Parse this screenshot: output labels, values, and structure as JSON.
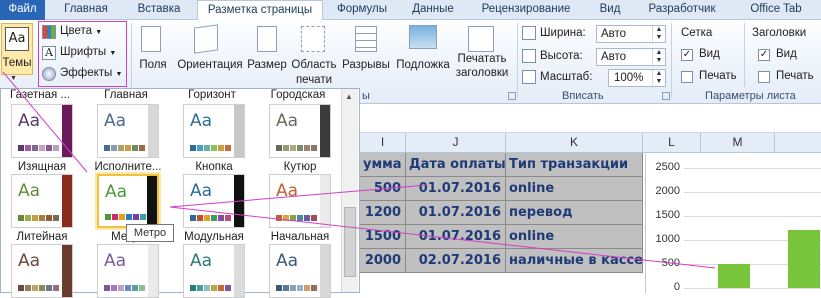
{
  "tabs": [
    {
      "label": "Файл",
      "kind": "file"
    },
    {
      "label": "Главная"
    },
    {
      "label": "Вставка"
    },
    {
      "label": "Разметка страницы",
      "kind": "active"
    },
    {
      "label": "Формулы"
    },
    {
      "label": "Данные"
    },
    {
      "label": "Рецензирование"
    },
    {
      "label": "Вид"
    },
    {
      "label": "Разработчик"
    },
    {
      "label": "Office Tab"
    }
  ],
  "ribbon": {
    "themes_label": "Темы",
    "colors_label": "Цвета",
    "fonts_label": "Шрифты",
    "effects_label": "Эффекты",
    "fields_label": "Поля",
    "orientation_label": "Ориентация",
    "size_label": "Размер",
    "print_area_label_1": "Область",
    "print_area_label_2": "печати",
    "breaks_label": "Разрывы",
    "background_label": "Подложка",
    "print_titles_label_1": "Печатать",
    "print_titles_label_2": "заголовки",
    "width_label": "Ширина:",
    "width_value": "Авто",
    "height_label": "Высота:",
    "height_value": "Авто",
    "scale_label": "Масштаб:",
    "scale_value": "100%",
    "fit_group_label": "Вписать",
    "page_setup_partial": "ы",
    "grid_label": "Сетка",
    "headings_label": "Заголовки",
    "view_label": "Вид",
    "print_label": "Печать",
    "sheet_options_label": "Параметры листа"
  },
  "gallery": {
    "top_labels": [
      "Газетная ...",
      "Главная",
      "Горизонт",
      "Городская"
    ],
    "row1": [
      {
        "name": "Изящная",
        "colors": [
          "#5a3a6e",
          "#a35c9e",
          "#7a6a8c",
          "#c8a0c4",
          "#8a5a8c",
          "#b3a3c2"
        ],
        "stripe": "#6a1a5a"
      },
      {
        "name": "Исполните...",
        "colors": [
          "#4b6a8e",
          "#8a9ab0",
          "#b0a070",
          "#c8a040",
          "#6a8a6a",
          "#9a6a4a"
        ],
        "stripe": "#d8d8d8"
      },
      {
        "name": "Кнопка",
        "colors": [
          "#2e6c94",
          "#4aa0c8",
          "#6ab0a0",
          "#8ac060",
          "#c8a040",
          "#d06a3a"
        ],
        "stripe": "#c8c8c8"
      },
      {
        "name": "Кутюр",
        "colors": [
          "#6a6a5a",
          "#9a9a7a",
          "#b0a880",
          "#7a8a6a",
          "#a08070",
          "#8a7a6a"
        ],
        "stripe": "#3a3a3a"
      }
    ],
    "row2": [
      {
        "name": "Литейная",
        "colors": [
          "#6a8a3a",
          "#9ab050",
          "#c0a040",
          "#b07a3a",
          "#8a5a3a",
          "#7a6a5a"
        ],
        "stripe": "#8a2a1a"
      },
      {
        "name": "Метро",
        "colors": [
          "#4a9a3a",
          "#d02a6a",
          "#e0a020",
          "#2a7ac0",
          "#7a3ab0",
          "#3aa0a0"
        ],
        "stripe": "#111"
      },
      {
        "name": "Модульная",
        "colors": [
          "#2a6aa0",
          "#d04a2a",
          "#e0a030",
          "#3a9a6a",
          "#8a4aa0",
          "#c04a7a"
        ],
        "stripe": "#111"
      },
      {
        "name": "Начальная",
        "colors": [
          "#c06030",
          "#e0a040",
          "#8aa050",
          "#4a8aa0",
          "#6a5aa0",
          "#a04a5a"
        ],
        "stripe": "#eaeaea"
      }
    ],
    "row3": [
      {
        "name": "",
        "colors": [
          "#6a4a3a",
          "#9a7a5a",
          "#c0a070",
          "#8a8a5a",
          "#6a7a8a",
          "#9a6a7a"
        ],
        "stripe": "#6a3a2a"
      },
      {
        "name": "",
        "colors": [
          "#7a5a9a",
          "#a07ac0",
          "#c0a0d0",
          "#6a8ac0",
          "#5aa0a0",
          "#8ac08a"
        ],
        "stripe": "#eaeaea"
      },
      {
        "name": "",
        "colors": [
          "#2a7a7a",
          "#4aa0a0",
          "#8ac0c0",
          "#c0a040",
          "#c06a3a",
          "#7a5a9a"
        ],
        "stripe": "#dcdcdc"
      },
      {
        "name": "",
        "colors": [
          "#3a5a7a",
          "#5a7a9a",
          "#8aa0c0",
          "#a0b0c8",
          "#c8a06a",
          "#9a6a5a"
        ],
        "stripe": "#d8d8d8"
      }
    ],
    "tooltip": "Метро"
  },
  "sheet": {
    "columns": [
      "I",
      "J",
      "K",
      "L",
      "M"
    ],
    "header": [
      "умма",
      "Дата оплаты",
      "Тип транзакции"
    ],
    "rows": [
      {
        "sum": "500",
        "date": "01.07.2016",
        "type": "online"
      },
      {
        "sum": "1200",
        "date": "01.07.2016",
        "type": "перевод"
      },
      {
        "sum": "1500",
        "date": "01.07.2016",
        "type": "online"
      },
      {
        "sum": "2000",
        "date": "02.07.2016",
        "type": "наличные в кассе"
      }
    ]
  },
  "chart_data": {
    "type": "bar",
    "yticks": [
      "2500",
      "2000",
      "1500",
      "1000",
      "500",
      "0"
    ],
    "ylim": [
      0,
      2500
    ],
    "values": [
      500,
      1200
    ],
    "colors": {
      "bar": "#78c43a"
    }
  }
}
